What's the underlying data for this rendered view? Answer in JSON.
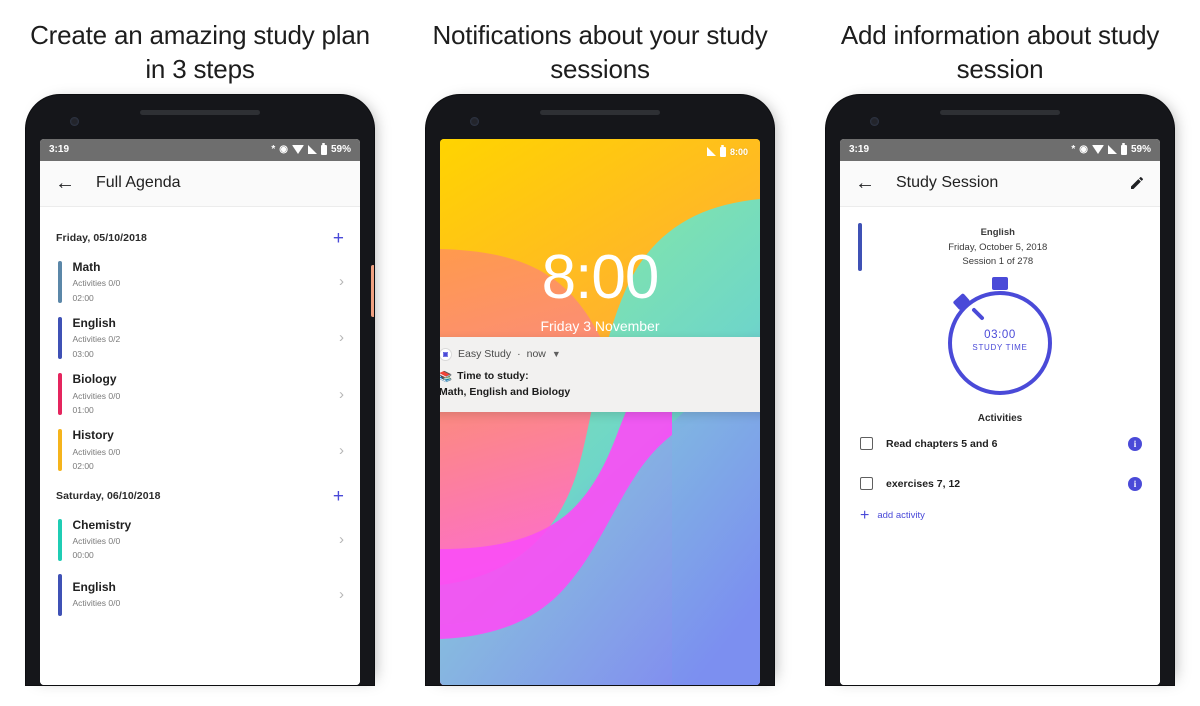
{
  "panels": [
    {
      "caption": "Create an amazing study plan in 3 steps",
      "phone": {
        "statusbar": {
          "time": "3:19",
          "battery": "59%"
        },
        "appbar": {
          "title": "Full Agenda",
          "back_icon": "arrow-left-icon"
        },
        "groups": [
          {
            "date": "Friday, 05/10/2018",
            "add_label": "+",
            "items": [
              {
                "name": "Math",
                "activities": "Activities 0/0",
                "duration": "02:00",
                "color": "#5b87a8"
              },
              {
                "name": "English",
                "activities": "Activities 0/2",
                "duration": "03:00",
                "color": "#3f51b5"
              },
              {
                "name": "Biology",
                "activities": "Activities 0/0",
                "duration": "01:00",
                "color": "#e5255e"
              },
              {
                "name": "History",
                "activities": "Activities 0/0",
                "duration": "02:00",
                "color": "#f5b41c"
              }
            ]
          },
          {
            "date": "Saturday, 06/10/2018",
            "add_label": "+",
            "items": [
              {
                "name": "Chemistry",
                "activities": "Activities 0/0",
                "duration": "00:00",
                "color": "#1fcdb4"
              },
              {
                "name": "English",
                "activities": "Activities 0/0",
                "duration": "",
                "color": "#3f51b5"
              }
            ]
          }
        ]
      }
    },
    {
      "caption": "Notifications about your study sessions",
      "phone": {
        "lockscreen": {
          "status_time": "8:00",
          "clock": "8:00",
          "date": "Friday 3 November"
        },
        "notification": {
          "app_name": "Easy Study",
          "separator": "·",
          "time": "now",
          "expand_icon": "chevron-down-icon",
          "emoji": "📚",
          "title": "Time to study:",
          "body": "Math, English and Biology"
        }
      }
    },
    {
      "caption": "Add information about study session",
      "phone": {
        "statusbar": {
          "time": "3:19",
          "battery": "59%"
        },
        "appbar": {
          "title": "Study Session",
          "back_icon": "arrow-left-icon",
          "edit_icon": "pencil-icon"
        },
        "session": {
          "subject": "English",
          "date": "Friday, October 5, 2018",
          "counter": "Session 1 of 278",
          "accent_color": "#3f51b5",
          "timer_value": "03:00",
          "timer_label": "STUDY TIME",
          "activities_title": "Activities",
          "activities": [
            {
              "label": "Read chapters 5 and 6",
              "checked": false,
              "info": "i"
            },
            {
              "label": "exercises 7, 12",
              "checked": false,
              "info": "i"
            }
          ],
          "add_activity": {
            "plus": "+",
            "label": "add activity"
          }
        }
      }
    }
  ],
  "colors": {
    "accent": "#4a4ad8",
    "statusbar_bg": "#6e6e6e",
    "appbar_bg": "#fafafa"
  }
}
